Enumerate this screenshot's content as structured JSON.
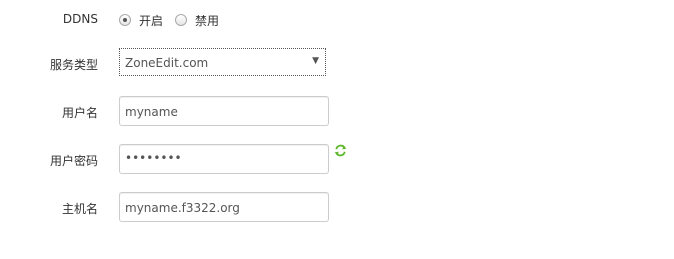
{
  "ddns": {
    "label": "DDNS",
    "options": [
      {
        "label": "开启",
        "checked": true
      },
      {
        "label": "禁用",
        "checked": false
      }
    ]
  },
  "service": {
    "label": "服务类型",
    "selected": "ZoneEdit.com"
  },
  "username": {
    "label": "用户名",
    "value": "myname"
  },
  "password": {
    "label": "用户密码",
    "value": "••••••••",
    "reveal_icon": "refresh-icon",
    "reveal_icon_color": "#5cb82a"
  },
  "hostname": {
    "label": "主机名",
    "value": "myname.f3322.org"
  }
}
